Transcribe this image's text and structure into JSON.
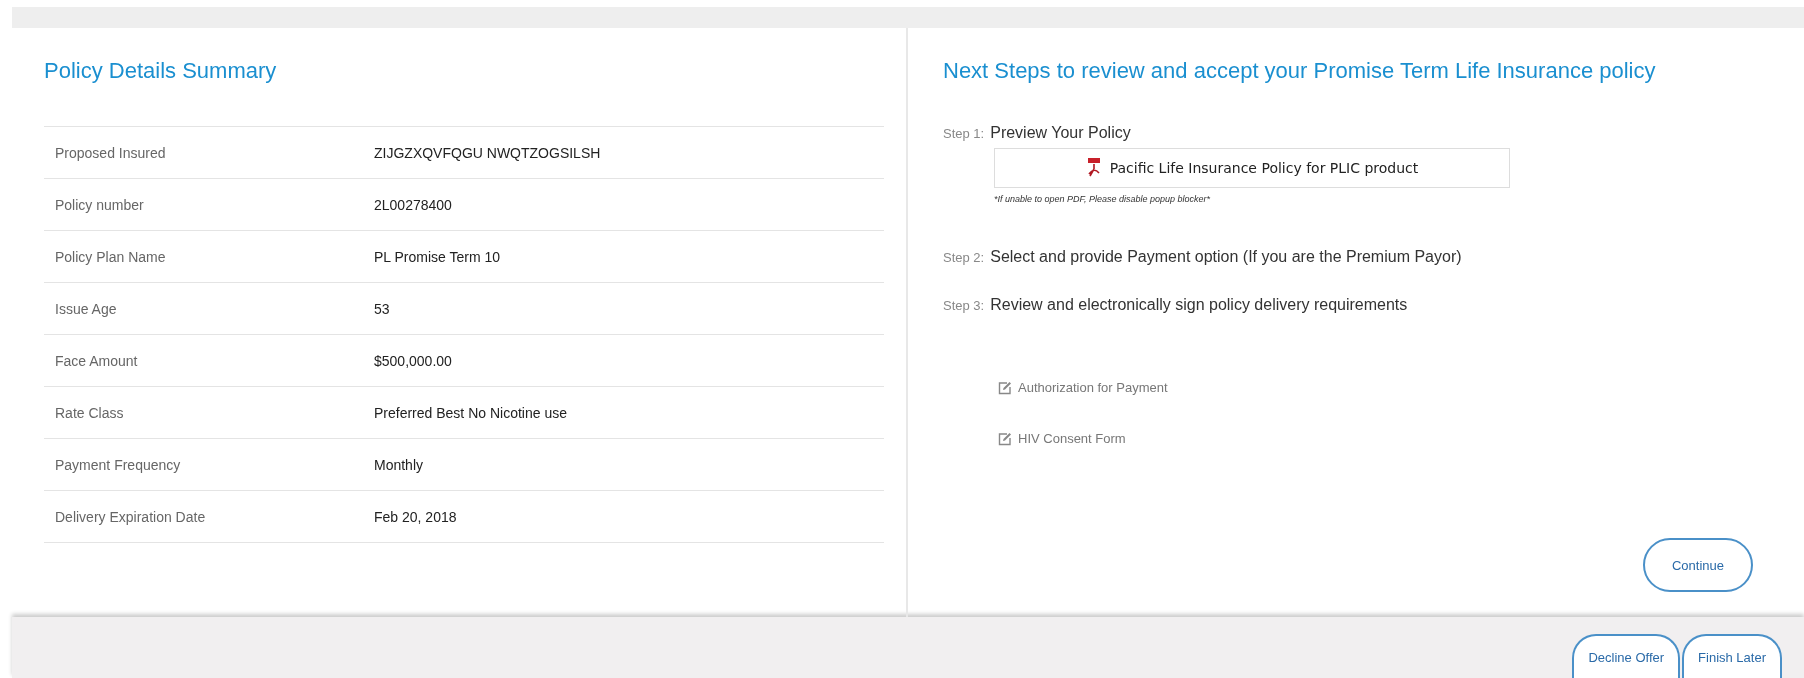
{
  "summary": {
    "title": "Policy Details Summary",
    "rows": [
      {
        "label": "Proposed Insured",
        "value": "ZIJGZXQVFQGU NWQTZOGSILSH"
      },
      {
        "label": "Policy number",
        "value": "2L00278400"
      },
      {
        "label": "Policy Plan Name",
        "value": "PL Promise Term 10"
      },
      {
        "label": "Issue Age",
        "value": "53"
      },
      {
        "label": "Face Amount",
        "value": "$500,000.00"
      },
      {
        "label": "Rate Class",
        "value": "Preferred Best No Nicotine use"
      },
      {
        "label": "Payment Frequency",
        "value": "Monthly"
      },
      {
        "label": "Delivery Expiration Date",
        "value": "Feb 20, 2018"
      }
    ]
  },
  "next_steps": {
    "title": "Next Steps to review and accept your Promise Term Life Insurance policy",
    "steps": [
      {
        "label": "Step 1:",
        "text": "Preview Your Policy",
        "document": {
          "title": "Pacific Life Insurance Policy for PLIC product",
          "note": "*If unable to open PDF, Please disable popup blocker*"
        }
      },
      {
        "label": "Step 2:",
        "text": "Select and provide Payment option (If you are the Premium Payor)"
      },
      {
        "label": "Step 3:",
        "text": "Review and electronically sign policy delivery requirements"
      }
    ],
    "requirements": [
      "Authorization for Payment",
      "HIV Consent Form"
    ],
    "continue_button": "Continue"
  },
  "footer_buttons": [
    "Decline Offer",
    "Finish Later"
  ]
}
